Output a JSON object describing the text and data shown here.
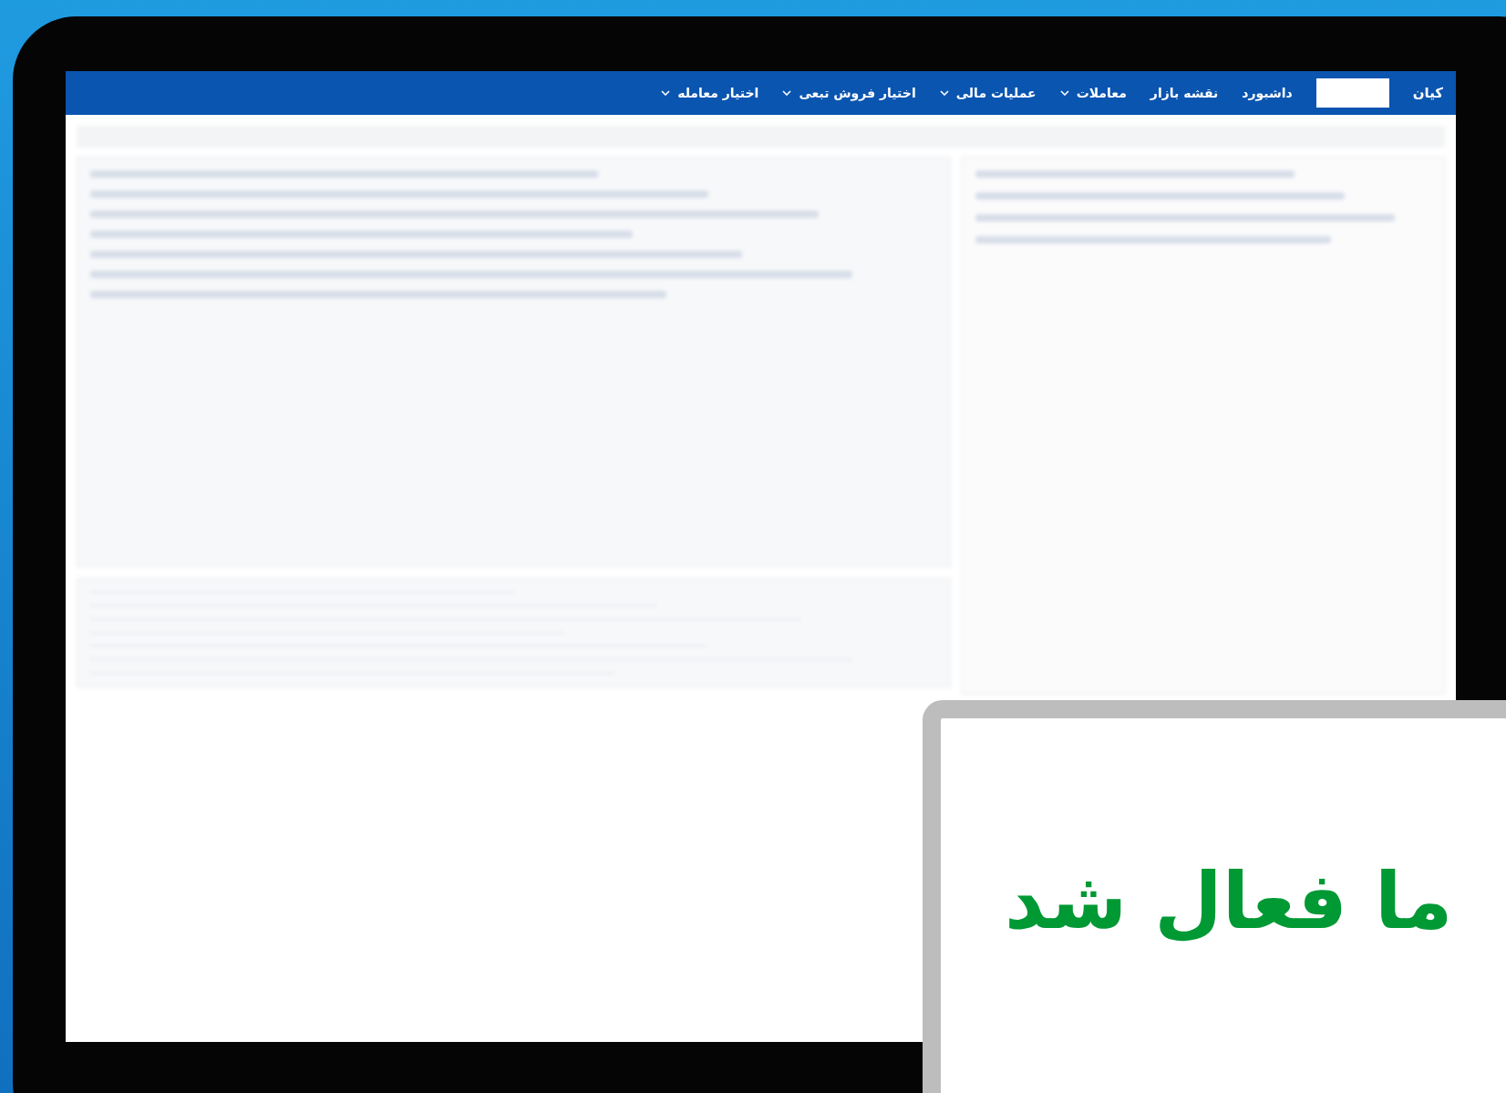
{
  "nav": {
    "logo": "کیان",
    "items": [
      {
        "label": "داشبورد",
        "dropdown": false
      },
      {
        "label": "نقشه بازار",
        "dropdown": false
      },
      {
        "label": "معاملات",
        "dropdown": true
      },
      {
        "label": "عملیات مالی",
        "dropdown": true
      },
      {
        "label": "اختیار فروش تبعی",
        "dropdown": true
      },
      {
        "label": "اختیار معامله",
        "dropdown": true
      }
    ]
  },
  "popup": {
    "message": "ما فعال شد"
  }
}
